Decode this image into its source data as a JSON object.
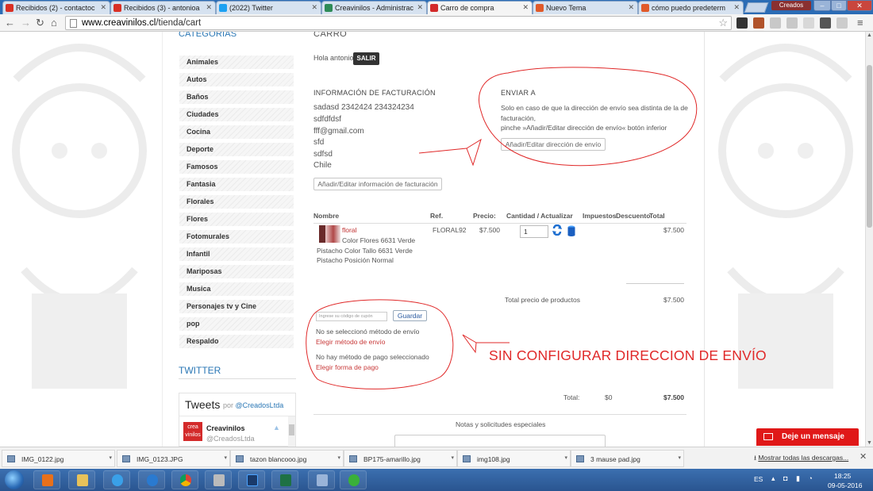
{
  "browser": {
    "tabs": [
      {
        "label": "Recibidos (2) - contactoc",
        "icon_color": "#d93025"
      },
      {
        "label": "Recibidos (3) - antonioa",
        "icon_color": "#d93025"
      },
      {
        "label": "(2022) Twitter",
        "icon_color": "#1da1f2"
      },
      {
        "label": "Creavinilos - Administrac",
        "icon_color": "#2e8b57"
      },
      {
        "label": "Carro de compra",
        "icon_color": "#d32a2a"
      },
      {
        "label": "Nuevo Tema",
        "icon_color": "#e05a2a"
      },
      {
        "label": "cómo puedo predeterm",
        "icon_color": "#e05a2a"
      }
    ],
    "active_tab_index": 4,
    "profile_label": "Creados",
    "url_host": "www.creavinilos.cl",
    "url_path": "/tienda/cart"
  },
  "sidebar": {
    "categories_title": "CATEGORIAS",
    "categories": [
      "Animales",
      "Autos",
      "Baños",
      "Ciudades",
      "Cocina",
      "Deporte",
      "Famosos",
      "Fantasia",
      "Florales",
      "Flores",
      "Fotomurales",
      "Infantil",
      "Mariposas",
      "Musica",
      "Personajes tv y Cine",
      "pop",
      "Respaldo"
    ],
    "twitter_title": "TWITTER",
    "tweets": {
      "title": "Tweets",
      "by_prefix": "por",
      "by_handle": "@CreadosLtda",
      "account_name": "Creavinilos",
      "account_handle": "@CreadosLtda",
      "avatar_text": "crea vinilos"
    }
  },
  "cart": {
    "title": "CARRO",
    "greeting": "Hola antonio",
    "logout_label": "SALIR",
    "billing": {
      "title": "INFORMACIÓN DE FACTURACIÓN",
      "lines": [
        "sadasd 2342424 234324234",
        "sdfdfdsf",
        "fff@gmail.com",
        "sfd",
        "sdfsd",
        "Chile"
      ],
      "edit_button": "Añadir/Editar información de facturación"
    },
    "shipping": {
      "title": "ENVIAR A",
      "text_line1": "Solo en caso de que la dirección de envío sea distinta de la de facturación,",
      "text_line2": "pinche »Añadir/Editar dirección de envío« botón inferior",
      "edit_button": "Añadir/Editar dirección de envío"
    },
    "table": {
      "headers": {
        "name": "Nombre",
        "ref": "Ref.",
        "price": "Precio:",
        "qty": "Cantidad / Actualizar",
        "tax": "Impuestos",
        "discount": "Descuento",
        "total": "Total"
      },
      "product": {
        "name": "floral",
        "description": "Color Flores 6631 Verde Pistacho Color Tallo 6631 Verde Pistacho Posición Normal",
        "ref": "FLORAL92",
        "price": "$7.500",
        "qty": "1",
        "total": "$7.500"
      }
    },
    "subtotal_label": "Total precio de productos",
    "subtotal_value": "$7.500",
    "coupon_placeholder": "Ingrese su código de cupón",
    "coupon_button": "Guardar",
    "no_shipping": "No se seleccionó método de envío",
    "choose_shipping": "Elegir método de envío",
    "no_payment": "No hay método de pago seleccionado",
    "choose_payment": "Elegir forma de pago",
    "total_label": "Total:",
    "total_mid": "$0",
    "total_value": "$7.500",
    "notes_label": "Notas y solicitudes especiales"
  },
  "annotation": {
    "text": "SIN CONFIGURAR DIRECCION DE ENVÍO",
    "color": "#e02828"
  },
  "chat": {
    "label": "Deje un mensaje"
  },
  "downloads": {
    "items": [
      "IMG_0122.jpg",
      "IMG_0123.JPG",
      "tazon blancooo.jpg",
      "BP175-amarillo.jpg",
      "img108.jpg",
      "3 mause pad.jpg"
    ],
    "show_all": "Mostrar todas las descargas..."
  },
  "taskbar": {
    "apps": [
      "media-player",
      "file-explorer",
      "internet-explorer",
      "firefox-app",
      "chrome",
      "sound-app",
      "photoshop",
      "excel",
      "remote-desktop",
      "green-app"
    ],
    "language": "ES",
    "time": "18:25",
    "date": "09-05-2016"
  }
}
